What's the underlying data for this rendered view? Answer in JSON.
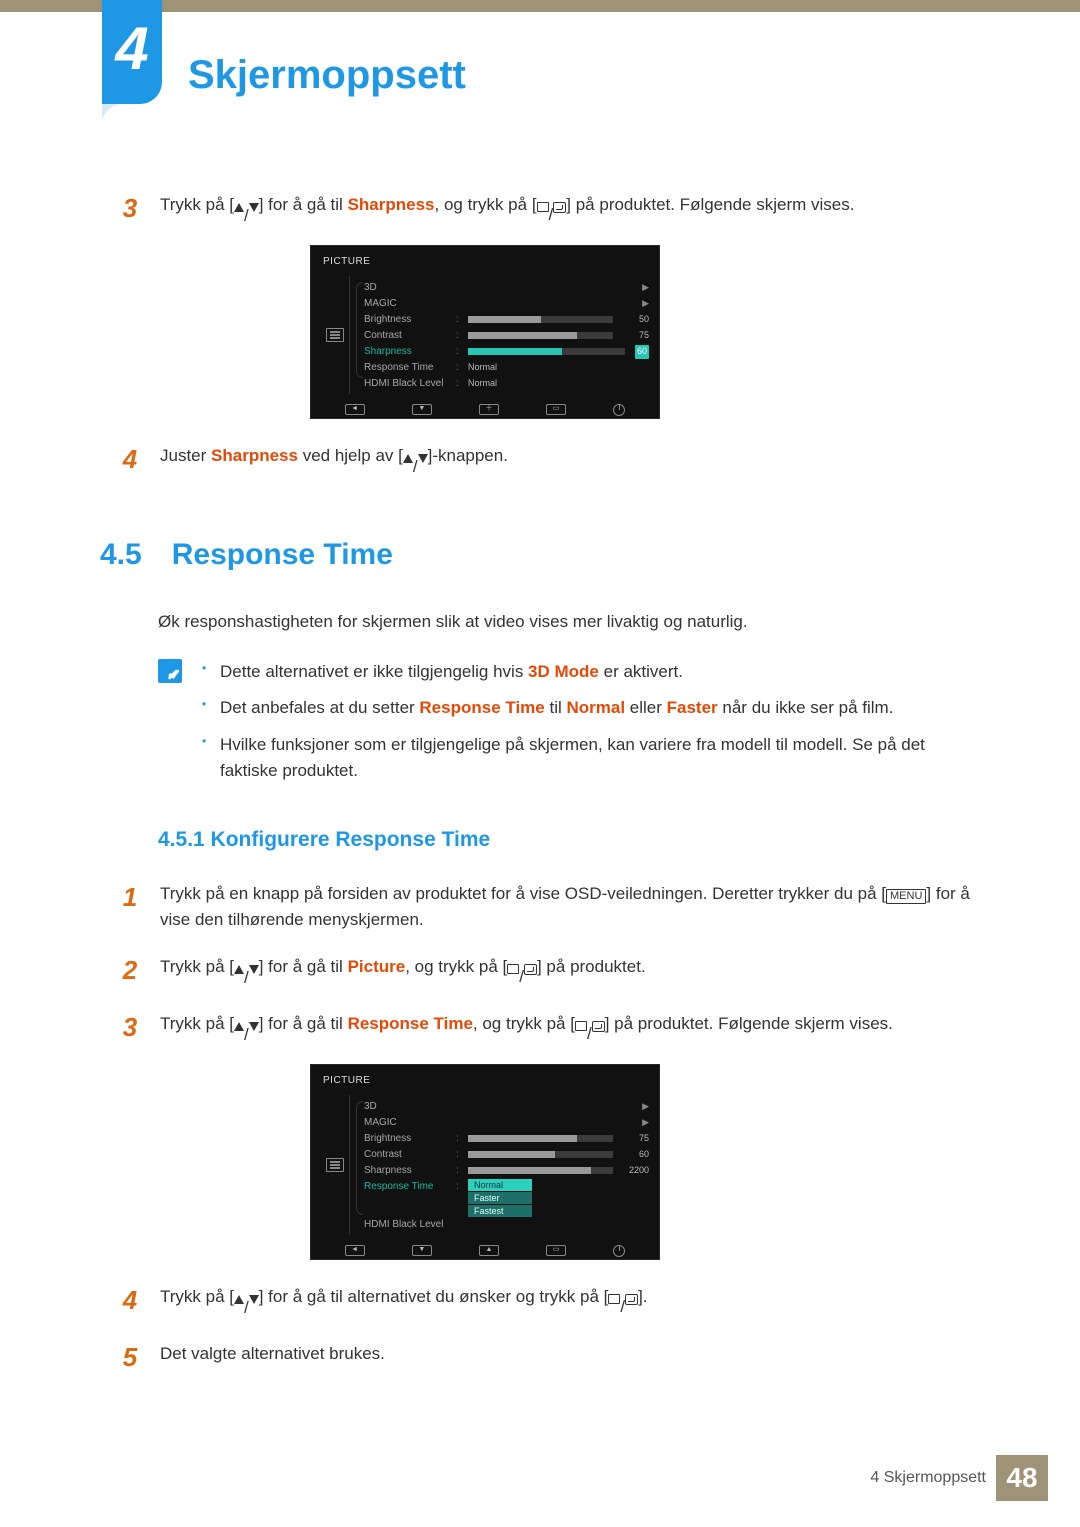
{
  "chapter": {
    "number": "4",
    "title": "Skjermoppsett"
  },
  "top_steps": {
    "s3": {
      "n": "3",
      "pre": "Trykk på [",
      "mid1": "] for å gå til ",
      "kw": "Sharpness",
      "mid2": ", og trykk på [",
      "post": "] på produktet. Følgende skjerm vises."
    },
    "s4": {
      "n": "4",
      "t1": "Juster ",
      "kw": "Sharpness",
      "t2": " ved hjelp av [",
      "t3": "]-knappen."
    }
  },
  "osd1": {
    "header": "PICTURE",
    "rows": [
      {
        "label": "3D",
        "type": "nav"
      },
      {
        "label": "MAGIC",
        "type": "nav"
      },
      {
        "label": "Brightness",
        "type": "bar",
        "value": 50,
        "fill": 50
      },
      {
        "label": "Contrast",
        "type": "bar",
        "value": 75,
        "fill": 75
      },
      {
        "label": "Sharpness",
        "type": "bar",
        "value": 60,
        "fill": 60,
        "selected": true
      },
      {
        "label": "Response Time",
        "type": "text",
        "value": "Normal"
      },
      {
        "label": "HDMI Black Level",
        "type": "text",
        "value": "Normal"
      }
    ]
  },
  "section": {
    "num": "4.5",
    "title": "Response Time"
  },
  "intro": "Øk responshastigheten for skjermen slik at video vises mer livaktig og naturlig.",
  "notes": {
    "n1a": "Dette alternativet er ikke tilgjengelig hvis ",
    "n1b": "3D Mode",
    "n1c": " er aktivert.",
    "n2a": "Det anbefales at du setter ",
    "n2b": "Response Time",
    "n2c": " til ",
    "n2d": "Normal",
    "n2e": " eller ",
    "n2f": "Faster",
    "n2g": " når du ikke ser på film.",
    "n3": "Hvilke funksjoner som er tilgjengelige på skjermen, kan variere fra modell til modell. Se på det faktiske produktet."
  },
  "subsection": "4.5.1 Konfigurere Response Time",
  "steps2": {
    "s1": {
      "n": "1",
      "a": "Trykk på en knapp på forsiden av produktet for å vise OSD-veiledningen. Deretter trykker du på [",
      "menu": "MENU",
      "b": "] for å vise den tilhørende menyskjermen."
    },
    "s2": {
      "n": "2",
      "a": "Trykk på [",
      "b": "] for å gå til ",
      "kw": "Picture",
      "c": ", og trykk på [",
      "d": "] på produktet."
    },
    "s3": {
      "n": "3",
      "a": "Trykk på [",
      "b": "] for å gå til ",
      "kw": "Response Time",
      "c": ", og trykk på [",
      "d": "] på produktet. Følgende skjerm vises."
    },
    "s4": {
      "n": "4",
      "a": "Trykk på [",
      "b": "] for å gå til alternativet du ønsker og trykk på [",
      "c": "]."
    },
    "s5": {
      "n": "5",
      "a": "Det valgte alternativet brukes."
    }
  },
  "osd2": {
    "header": "PICTURE",
    "rows": [
      {
        "label": "3D",
        "type": "nav"
      },
      {
        "label": "MAGIC",
        "type": "nav"
      },
      {
        "label": "Brightness",
        "type": "bar",
        "value": 75,
        "fill": 75
      },
      {
        "label": "Contrast",
        "type": "bar",
        "value": 60,
        "fill": 60
      },
      {
        "label": "Sharpness",
        "type": "bar",
        "value": 2200,
        "fill": 85
      },
      {
        "label": "Response Time",
        "type": "opts",
        "selected": true,
        "options": [
          "Normal",
          "Faster",
          "Fastest"
        ],
        "sel": 0
      },
      {
        "label": "HDMI Black Level",
        "type": "blank"
      }
    ]
  },
  "footer": {
    "label": "4 Skjermoppsett",
    "page": "48"
  }
}
